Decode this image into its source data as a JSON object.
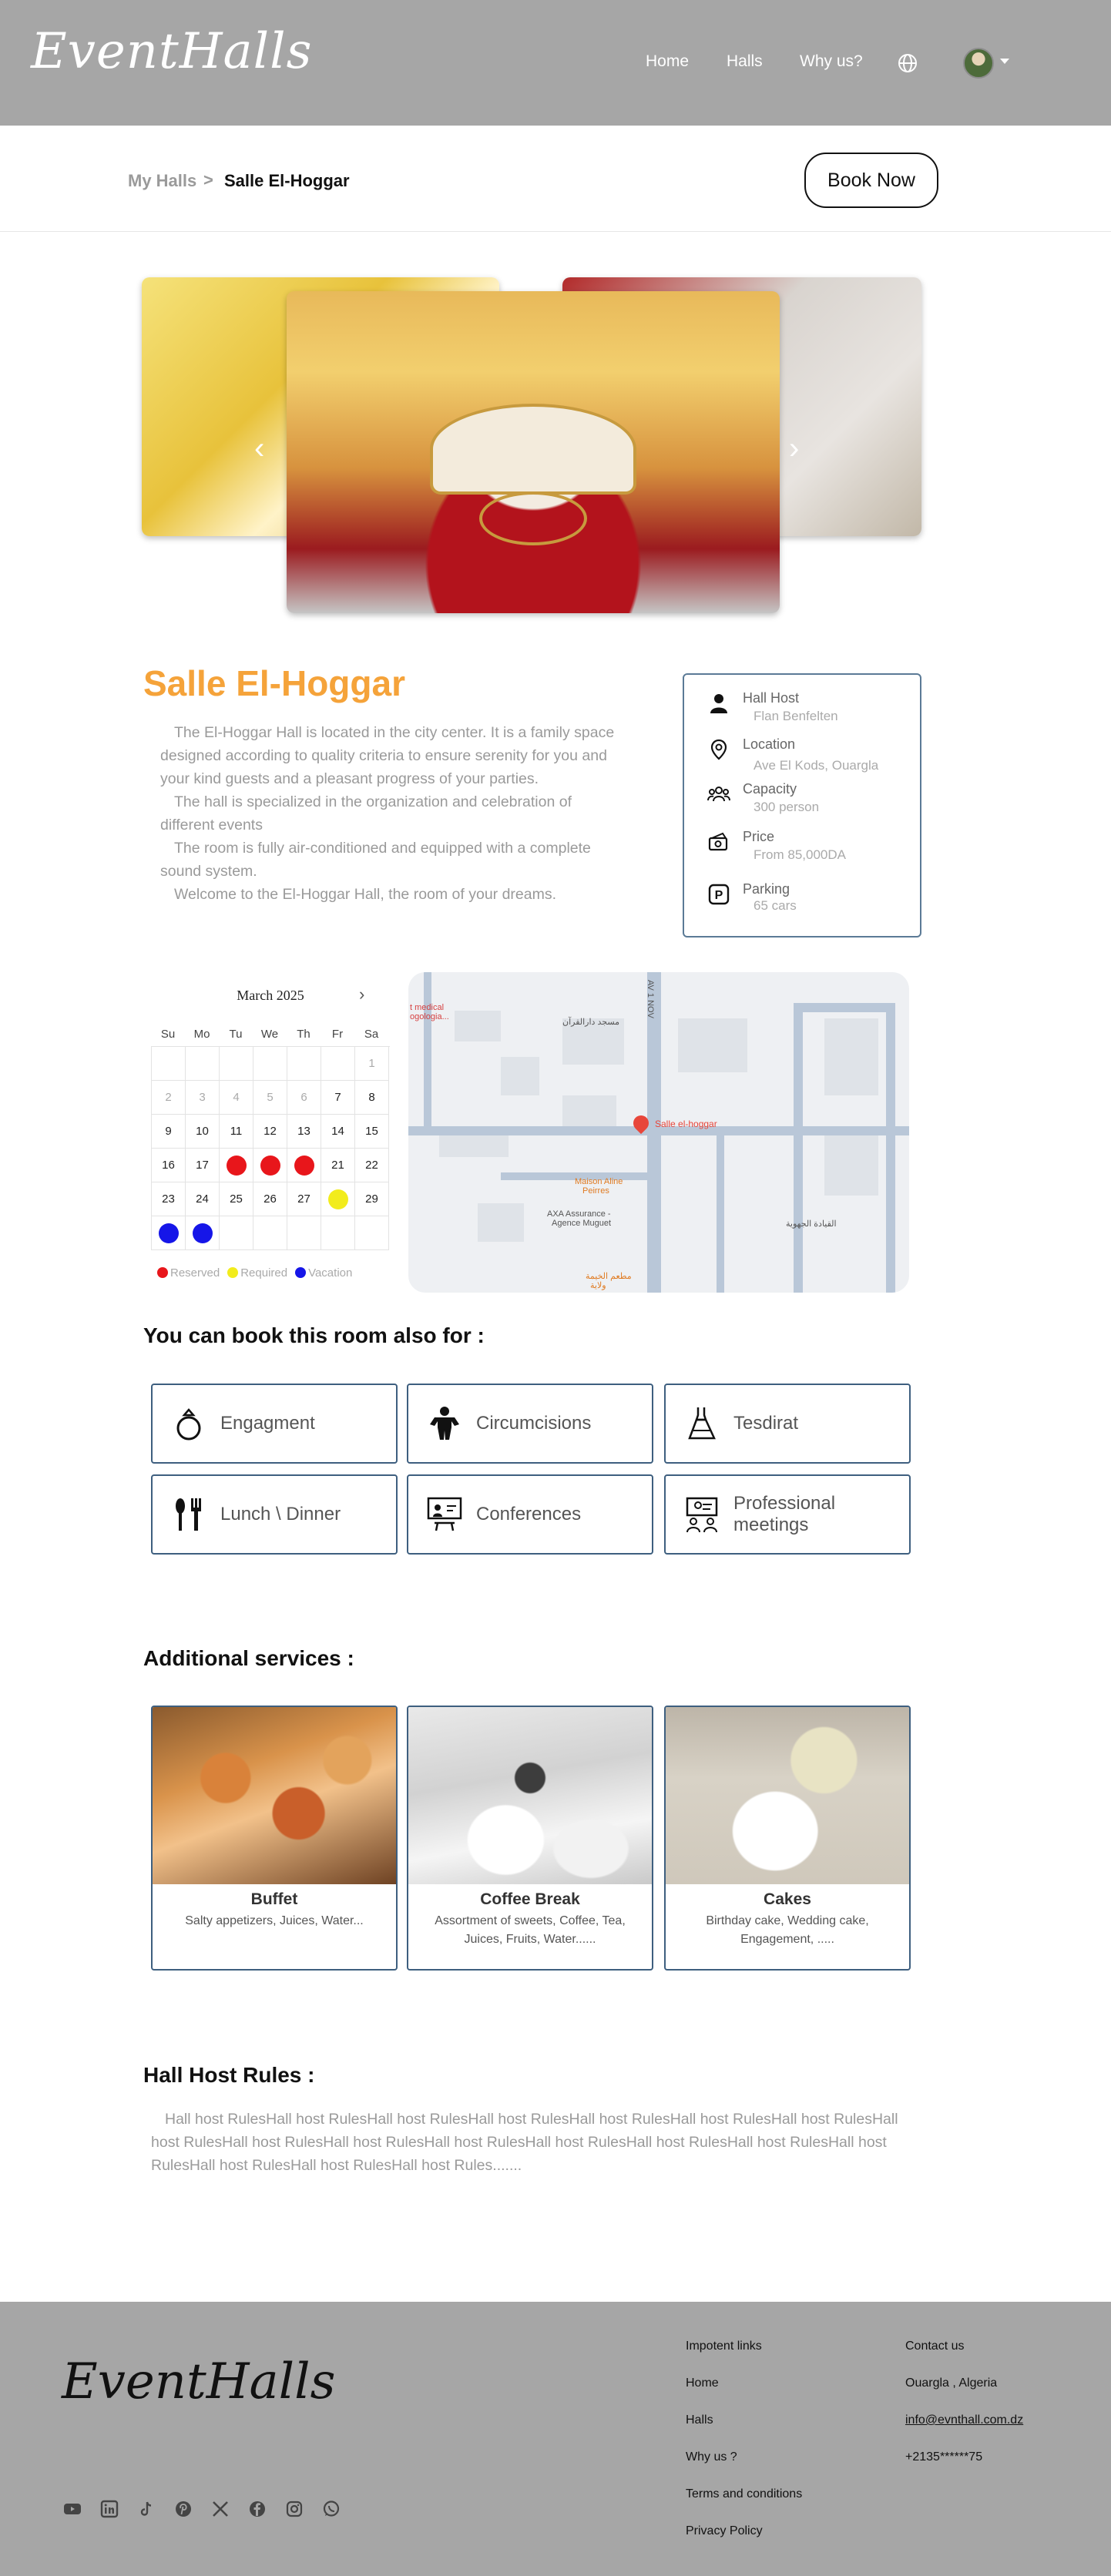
{
  "header": {
    "logo": "EventHalls",
    "nav": [
      "Home",
      "Halls",
      "Why us?"
    ],
    "icons": [
      "globe-icon",
      "avatar-icon",
      "caret-down-icon"
    ]
  },
  "breadcrumb": {
    "parent": "My Halls",
    "separator": ">",
    "current": "Salle El-Hoggar"
  },
  "book_now": "Book Now",
  "hall": {
    "title": "Salle El-Hoggar",
    "description": [
      "The El-Hoggar Hall is located in the city center. It is a family space designed according to quality criteria to ensure serenity for you and your kind guests and a pleasant progress of your parties.",
      "The hall is specialized in the organization and celebration of different events",
      "The room is fully air-conditioned and equipped with a complete sound system.",
      "Welcome to the El-Hoggar Hall, the room of your dreams."
    ],
    "info": [
      {
        "label": "Hall Host",
        "value": "Flan Benfelten",
        "icon": "user-icon"
      },
      {
        "label": "Location",
        "value": "Ave El Kods, Ouargla",
        "icon": "location-pin-icon"
      },
      {
        "label": "Capacity",
        "value": "300 person",
        "icon": "group-icon"
      },
      {
        "label": "Price",
        "value": "From 85,000DA",
        "icon": "money-icon"
      },
      {
        "label": "Parking",
        "value": "65 cars",
        "icon": "parking-icon"
      }
    ]
  },
  "calendar": {
    "month": "March 2025",
    "weekdays": [
      "Su",
      "Mo",
      "Tu",
      "We",
      "Th",
      "Fr",
      "Sa"
    ],
    "days": [
      {
        "d": "",
        "s": ""
      },
      {
        "d": "",
        "s": ""
      },
      {
        "d": "",
        "s": ""
      },
      {
        "d": "",
        "s": ""
      },
      {
        "d": "",
        "s": ""
      },
      {
        "d": "",
        "s": ""
      },
      {
        "d": "1",
        "s": "muted"
      },
      {
        "d": "2",
        "s": "muted"
      },
      {
        "d": "3",
        "s": "muted"
      },
      {
        "d": "4",
        "s": "muted"
      },
      {
        "d": "5",
        "s": "muted"
      },
      {
        "d": "6",
        "s": "muted"
      },
      {
        "d": "7",
        "s": ""
      },
      {
        "d": "8",
        "s": ""
      },
      {
        "d": "9",
        "s": ""
      },
      {
        "d": "10",
        "s": ""
      },
      {
        "d": "11",
        "s": ""
      },
      {
        "d": "12",
        "s": ""
      },
      {
        "d": "13",
        "s": ""
      },
      {
        "d": "14",
        "s": ""
      },
      {
        "d": "15",
        "s": ""
      },
      {
        "d": "16",
        "s": ""
      },
      {
        "d": "17",
        "s": ""
      },
      {
        "d": "",
        "s": "reserved"
      },
      {
        "d": "",
        "s": "reserved"
      },
      {
        "d": "",
        "s": "reserved"
      },
      {
        "d": "21",
        "s": ""
      },
      {
        "d": "22",
        "s": ""
      },
      {
        "d": "23",
        "s": ""
      },
      {
        "d": "24",
        "s": ""
      },
      {
        "d": "25",
        "s": ""
      },
      {
        "d": "26",
        "s": ""
      },
      {
        "d": "27",
        "s": ""
      },
      {
        "d": "",
        "s": "required"
      },
      {
        "d": "29",
        "s": ""
      },
      {
        "d": "",
        "s": "vacation"
      },
      {
        "d": "",
        "s": "vacation"
      },
      {
        "d": "",
        "s": ""
      },
      {
        "d": "",
        "s": ""
      },
      {
        "d": "",
        "s": ""
      },
      {
        "d": "",
        "s": ""
      },
      {
        "d": "",
        "s": ""
      }
    ],
    "legend": [
      {
        "label": "Reserved",
        "color": "#e8161b"
      },
      {
        "label": "Required",
        "color": "#f2ec1c"
      },
      {
        "label": "Vacation",
        "color": "#1616e8"
      }
    ]
  },
  "map": {
    "pin_label": "Salle el-hoggar",
    "labels": [
      "t medical",
      "ogologia...",
      "مسجد دارالقرآن",
      "AV 1 NOV",
      "Maison Aline",
      "Peirres",
      "AXA Assurance -",
      "Agence Muguet",
      "القيادة الجهوية",
      "مطعم الخيمة",
      "ولاية"
    ]
  },
  "booking": {
    "title": "You can book this room also for :",
    "types": [
      {
        "label": "Engagment",
        "icon": "ring-icon"
      },
      {
        "label": "Circumcisions",
        "icon": "child-icon"
      },
      {
        "label": "Tesdirat",
        "icon": "dress-icon"
      },
      {
        "label": "Lunch \\ Dinner",
        "icon": "cutlery-icon"
      },
      {
        "label": "Conferences",
        "icon": "presentation-icon"
      },
      {
        "label": "Professional meetings",
        "icon": "meeting-icon"
      }
    ]
  },
  "services": {
    "title": "Additional services :",
    "items": [
      {
        "title": "Buffet",
        "desc": "Salty appetizers, Juices, Water..."
      },
      {
        "title": "Coffee Break",
        "desc": "Assortment of sweets, Coffee, Tea,  Juices, Fruits, Water......"
      },
      {
        "title": "Cakes",
        "desc": "Birthday cake, Wedding cake, Engagement, ....."
      }
    ]
  },
  "rules": {
    "title": "Hall Host Rules :",
    "text": "Hall host RulesHall host RulesHall host RulesHall host RulesHall host RulesHall host RulesHall host RulesHall host RulesHall host RulesHall host RulesHall host RulesHall host RulesHall host RulesHall host RulesHall host RulesHall host RulesHall host RulesHall host Rules......."
  },
  "footer": {
    "logo": "EventHalls",
    "links_title": "Impotent links",
    "links": [
      "Home",
      "Halls",
      "Why us ?",
      "Terms and conditions",
      "Privacy Policy"
    ],
    "contact_title": "Contact us",
    "contact": [
      "Ouargla , Algeria",
      "info@evnthall.com.dz",
      "+2135******75"
    ],
    "social": [
      "youtube-icon",
      "linkedin-icon",
      "tiktok-icon",
      "pinterest-icon",
      "x-icon",
      "facebook-icon",
      "instagram-icon",
      "whatsapp-icon"
    ]
  }
}
